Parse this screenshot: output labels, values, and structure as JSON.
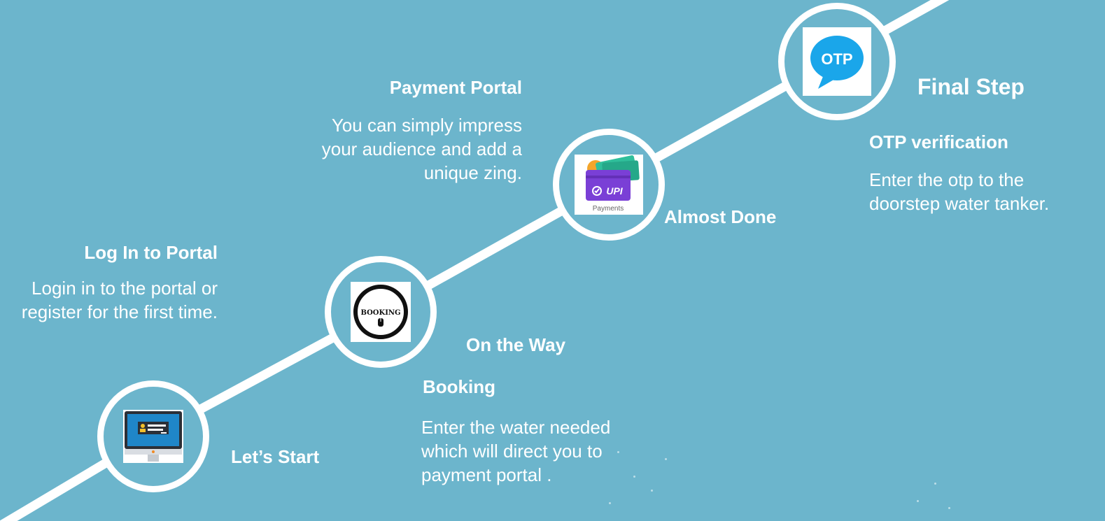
{
  "steps": [
    {
      "icon": "computer-login-icon",
      "caption": "Let’s Start",
      "title": "Log In to Portal",
      "description": "Login in to the portal or register for the first time."
    },
    {
      "icon": "booking-icon",
      "icon_text": "BOOKING",
      "caption": "On the Way",
      "title": "Booking",
      "description": "Enter the water needed which will direct you to payment portal ."
    },
    {
      "icon": "upi-wallet-icon",
      "icon_text": "UPI",
      "icon_subtext": "Payments",
      "caption": "Almost Done",
      "title": "Payment Portal",
      "description": "You can simply impress your audience and add a unique zing."
    },
    {
      "icon": "otp-chat-icon",
      "icon_text": "OTP",
      "caption": "Final Step",
      "title": "OTP verification",
      "description": "Enter the otp to the doorstep water tanker."
    }
  ],
  "colors": {
    "background": "#6cb5cc",
    "line": "#ffffff",
    "otp_blue": "#1aa6ea",
    "upi_purple": "#7a3fd6",
    "screen_blue": "#1f86c8"
  }
}
